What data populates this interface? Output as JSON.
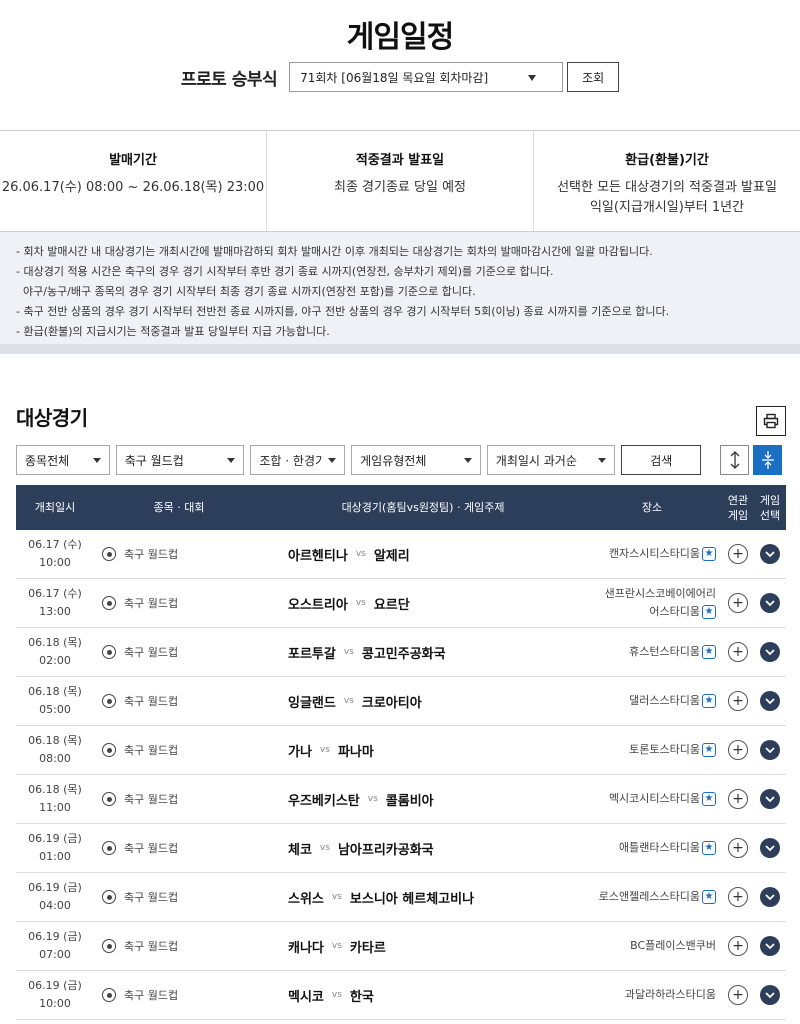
{
  "title": "게임일정",
  "round": {
    "label": "프로토 승부식",
    "selected": "71회차 [06월18일 목요일 회차마감]",
    "button": "조회"
  },
  "info": [
    {
      "heading": "발매기간",
      "value": "26.06.17(수) 08:00 ~ 26.06.18(목) 23:00"
    },
    {
      "heading": "적중결과 발표일",
      "value": "최종 경기종료 당일 예정"
    },
    {
      "heading": "환급(환불)기간",
      "value": "선택한 모든 대상경기의 적중결과 발표일\n익일(지급개시일)부터 1년간"
    }
  ],
  "notices": [
    "- 회차 발매시간 내 대상경기는 개최시간에 발매마감하되 회차 발매시간 이후 개최되는 대상경기는 회차의 발매마감시간에 일괄 마감됩니다.",
    "- 대상경기 적용 시간은 축구의 경우 경기 시작부터 후반 경기 종료 시까지(연장전, 승부차기 제외)를 기준으로 합니다.",
    "  야구/농구/배구 종목의 경우 경기 시작부터 최종 경기 종료 시까지(연장전 포함)를 기준으로 합니다.",
    "- 축구 전반 상품의 경우 경기 시작부터 전반전 종료 시까지를, 야구 전반 상품의 경우 경기 시작부터 5회(이닝) 종료 시까지를 기준으로 합니다.",
    "- 환급(환불)의 지급시기는 적중결과 발표 당일부터 지급 가능합니다."
  ],
  "section_title": "대상경기",
  "filters": {
    "sport": "종목전체",
    "league": "축구 월드컵",
    "combo": "조합 · 한경기",
    "game_type": "게임유형전체",
    "sort": "개최일시 과거순",
    "search": "검색"
  },
  "table_headers": {
    "date": "개최일시",
    "sport": "종목 · 대회",
    "match": "대상경기(홈팀vs원정팀) · 게임주제",
    "venue": "장소",
    "related": "연관\n게임",
    "select": "게임\n선택"
  },
  "vs_label": "vs",
  "rows": [
    {
      "date": "06.17 (수)",
      "time": "10:00",
      "sport": "축구 월드컵",
      "home": "아르헨티나",
      "away": "알제리",
      "venue": "캔자스시티스타디움",
      "star": true
    },
    {
      "date": "06.17 (수)",
      "time": "13:00",
      "sport": "축구 월드컵",
      "home": "오스트리아",
      "away": "요르단",
      "venue": "샌프란시스코베이에어리\n어스타디움",
      "star": true
    },
    {
      "date": "06.18 (목)",
      "time": "02:00",
      "sport": "축구 월드컵",
      "home": "포르투갈",
      "away": "콩고민주공화국",
      "venue": "휴스턴스타디움",
      "star": true
    },
    {
      "date": "06.18 (목)",
      "time": "05:00",
      "sport": "축구 월드컵",
      "home": "잉글랜드",
      "away": "크로아티아",
      "venue": "댈러스스타디움",
      "star": true
    },
    {
      "date": "06.18 (목)",
      "time": "08:00",
      "sport": "축구 월드컵",
      "home": "가나",
      "away": "파나마",
      "venue": "토론토스타디움",
      "star": true
    },
    {
      "date": "06.18 (목)",
      "time": "11:00",
      "sport": "축구 월드컵",
      "home": "우즈베키스탄",
      "away": "콜롬비아",
      "venue": "멕시코시티스타디움",
      "star": true
    },
    {
      "date": "06.19 (금)",
      "time": "01:00",
      "sport": "축구 월드컵",
      "home": "체코",
      "away": "남아프리카공화국",
      "venue": "애틀랜타스타디움",
      "star": true
    },
    {
      "date": "06.19 (금)",
      "time": "04:00",
      "sport": "축구 월드컵",
      "home": "스위스",
      "away": "보스니아 헤르체고비나",
      "venue": "로스앤젤레스스타디움",
      "star": true
    },
    {
      "date": "06.19 (금)",
      "time": "07:00",
      "sport": "축구 월드컵",
      "home": "캐나다",
      "away": "카타르",
      "venue": "BC플레이스밴쿠버",
      "star": false
    },
    {
      "date": "06.19 (금)",
      "time": "10:00",
      "sport": "축구 월드컵",
      "home": "멕시코",
      "away": "한국",
      "venue": "과달라하라스타디움",
      "star": false
    }
  ]
}
